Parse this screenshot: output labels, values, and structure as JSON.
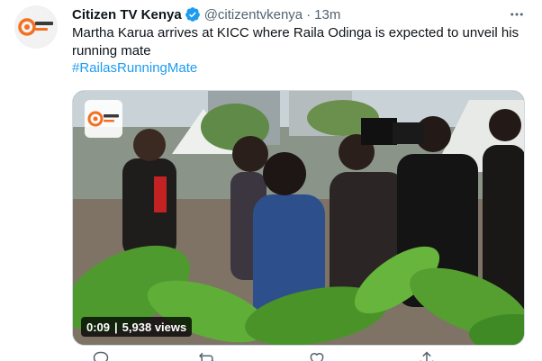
{
  "account": {
    "display_name": "Citizen TV Kenya",
    "handle": "@citizentvkenya",
    "separator": "·",
    "time": "13m",
    "verified_icon": "verified-badge-icon",
    "avatar_brand": "Citizen Digital"
  },
  "tweet": {
    "text": "Martha Karua arrives at KICC where Raila Odinga is expected to unveil his running mate",
    "hashtag": "#RailasRunningMate"
  },
  "media": {
    "watermark_brand": "Citizen Digital",
    "duration": "0:09",
    "separator": "|",
    "views": "5,938 views"
  },
  "icons": {
    "more": "more-options-icon",
    "reply": "reply-icon",
    "retweet": "retweet-icon",
    "like": "like-icon",
    "share": "share-icon"
  },
  "colors": {
    "accent": "#1d9bf0",
    "text_primary": "#0f1419",
    "text_secondary": "#536471",
    "brand_orange": "#f37021"
  }
}
